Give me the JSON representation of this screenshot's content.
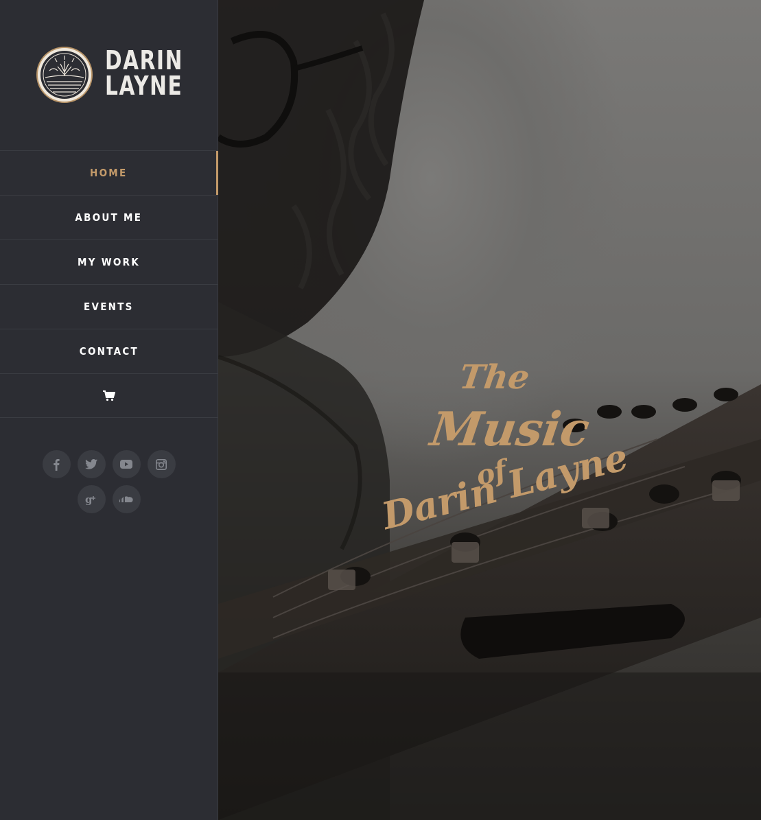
{
  "brand": {
    "line1": "DARIN",
    "line2": "LAYNE",
    "emblem_icon": "sun-wheat-emblem-icon"
  },
  "nav": {
    "items": [
      {
        "label": "HOME",
        "active": true
      },
      {
        "label": "ABOUT ME",
        "active": false
      },
      {
        "label": "MY WORK",
        "active": false
      },
      {
        "label": "EVENTS",
        "active": false
      },
      {
        "label": "CONTACT",
        "active": false
      }
    ],
    "cart_icon": "shopping-cart-icon"
  },
  "social": {
    "icons": [
      "facebook-icon",
      "twitter-icon",
      "youtube-icon",
      "instagram-icon",
      "google-plus-icon",
      "soundcloud-icon"
    ]
  },
  "hero": {
    "line1": "The",
    "line2": "Music",
    "line3": "of",
    "line4": "Darin Layne"
  },
  "colors": {
    "accent": "#c39a6a",
    "sidebar_bg": "#2c2d33",
    "divider": "#3a3c42",
    "nav_text": "#ffffff",
    "social_bg": "#3a3c42",
    "social_icon": "#84878e"
  }
}
